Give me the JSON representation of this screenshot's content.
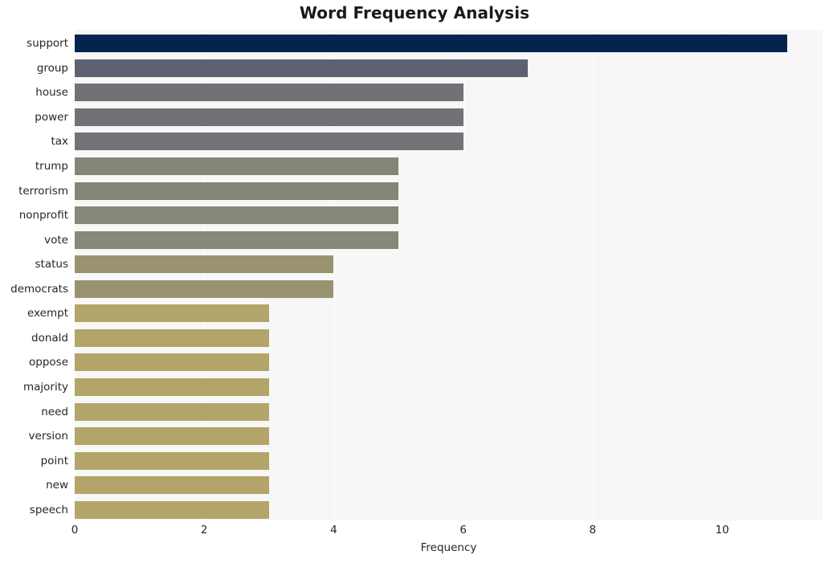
{
  "chart_data": {
    "type": "bar",
    "orientation": "horizontal",
    "title": "Word Frequency Analysis",
    "xlabel": "Frequency",
    "ylabel": "",
    "categories": [
      "support",
      "group",
      "house",
      "power",
      "tax",
      "trump",
      "terrorism",
      "nonprofit",
      "vote",
      "status",
      "democrats",
      "exempt",
      "donald",
      "oppose",
      "majority",
      "need",
      "version",
      "point",
      "new",
      "speech"
    ],
    "values": [
      11,
      7,
      6,
      6,
      6,
      5,
      5,
      5,
      5,
      4,
      4,
      3,
      3,
      3,
      3,
      3,
      3,
      3,
      3,
      3
    ],
    "bar_colors": [
      "#03244d",
      "#5d6172",
      "#717275",
      "#717275",
      "#727376",
      "#868678",
      "#868678",
      "#87877a",
      "#87877a",
      "#9a9372",
      "#9a9372",
      "#b3a569",
      "#b3a569",
      "#b3a569",
      "#b3a569",
      "#b3a569",
      "#b3a569",
      "#b3a569",
      "#b3a569",
      "#b3a569"
    ],
    "xlim": [
      0,
      11.55
    ],
    "x_ticks": [
      0,
      2,
      4,
      6,
      8,
      10
    ],
    "x_tick_labels": [
      "0",
      "2",
      "4",
      "6",
      "8",
      "10"
    ],
    "grid": true,
    "grid_axis": "x",
    "grid_color": "#ffffff",
    "plot_background": "#f7f7f7",
    "figure_background": "#ffffff",
    "legend": null,
    "legend_position": "none"
  }
}
